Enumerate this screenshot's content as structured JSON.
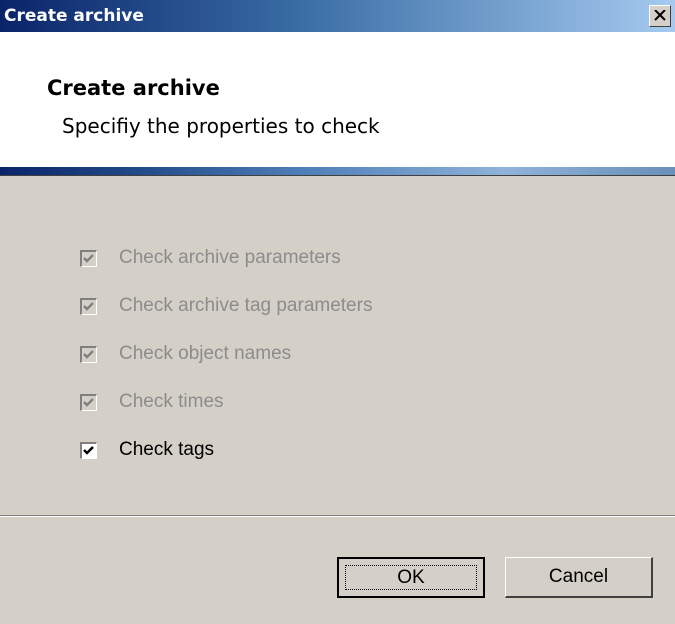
{
  "window": {
    "title": "Create archive",
    "close_icon": "close-icon"
  },
  "header": {
    "title": "Create archive",
    "subtitle": "Specifiy the properties to check"
  },
  "options": [
    {
      "label": "Check archive parameters",
      "checked": true,
      "enabled": false
    },
    {
      "label": "Check archive tag parameters",
      "checked": true,
      "enabled": false
    },
    {
      "label": "Check object names",
      "checked": true,
      "enabled": false
    },
    {
      "label": "Check times",
      "checked": true,
      "enabled": false
    },
    {
      "label": "Check tags",
      "checked": true,
      "enabled": true
    }
  ],
  "buttons": {
    "ok": "OK",
    "cancel": "Cancel"
  },
  "colors": {
    "titlebar_start": "#0a246a",
    "titlebar_end": "#a6caf0",
    "face": "#d4d0c8",
    "disabled_text": "#8c8c8c"
  }
}
